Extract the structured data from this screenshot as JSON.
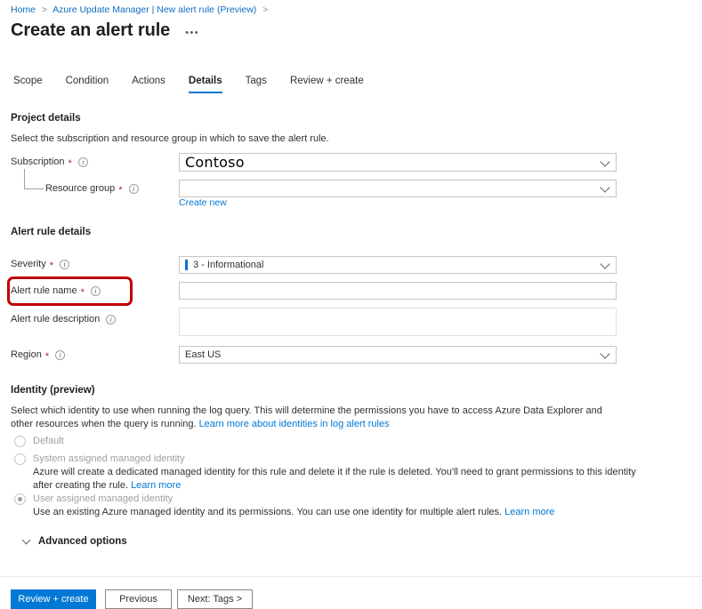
{
  "breadcrumb": {
    "items": [
      "Home",
      "Azure Update Manager | New alert rule (Preview)"
    ],
    "separator": ">",
    "trailing_separator": ">"
  },
  "header": {
    "title": "Create an alert rule",
    "more_label": "•••"
  },
  "tabs": [
    {
      "label": "Scope",
      "active": false
    },
    {
      "label": "Condition",
      "active": false
    },
    {
      "label": "Actions",
      "active": false
    },
    {
      "label": "Details",
      "active": true
    },
    {
      "label": "Tags",
      "active": false
    },
    {
      "label": "Review + create",
      "active": false
    }
  ],
  "project_details": {
    "heading": "Project details",
    "description": "Select the subscription and resource group in which to save the alert rule.",
    "subscription": {
      "label": "Subscription",
      "required": "*",
      "value": "Contoso",
      "placeholder": ""
    },
    "resource_group": {
      "label": "Resource group",
      "required": "*",
      "value": "",
      "placeholder": "",
      "create_new_label": "Create new"
    }
  },
  "alert_rule_details": {
    "heading": "Alert rule details",
    "severity": {
      "label": "Severity",
      "required": "*",
      "value": "3 - Informational",
      "accent_color": "#0078d4"
    },
    "alert_rule_name": {
      "label": "Alert rule name",
      "required": "*",
      "value": "",
      "placeholder": "",
      "highlighted": true
    },
    "alert_rule_description": {
      "label": "Alert rule description",
      "required": "",
      "value": "",
      "placeholder": ""
    },
    "region": {
      "label": "Region",
      "required": "*",
      "value": "East US"
    }
  },
  "identity": {
    "heading": "Identity (preview)",
    "description_part1": "Select which identity to use when running the log query. This will determine the permissions you have to access Azure Data Explorer and other resources when the query is running. ",
    "description_link": "Learn more about identities in log alert rules",
    "options": [
      {
        "label": "Default",
        "selected": false,
        "disabled": true,
        "description": "",
        "link": ""
      },
      {
        "label": "System assigned managed identity",
        "selected": false,
        "disabled": true,
        "description": "Azure will create a dedicated managed identity for this rule and delete it if the rule is deleted. You'll need to grant permissions to this identity after creating the rule. ",
        "link": "Learn more"
      },
      {
        "label": "User assigned managed identity",
        "selected": true,
        "disabled": true,
        "description": "Use an existing Azure managed identity and its permissions. You can use one identity for multiple alert rules. ",
        "link": "Learn more"
      }
    ]
  },
  "advanced_options": {
    "label": "Advanced options",
    "expanded": false
  },
  "footer": {
    "review_create_label": "Review + create",
    "previous_label": "Previous",
    "next_label": "Next: Tags >"
  },
  "colors": {
    "accent": "#0078d4",
    "required": "#a4262c",
    "highlight": "#c00000",
    "disabled_text": "#a19f9d"
  }
}
